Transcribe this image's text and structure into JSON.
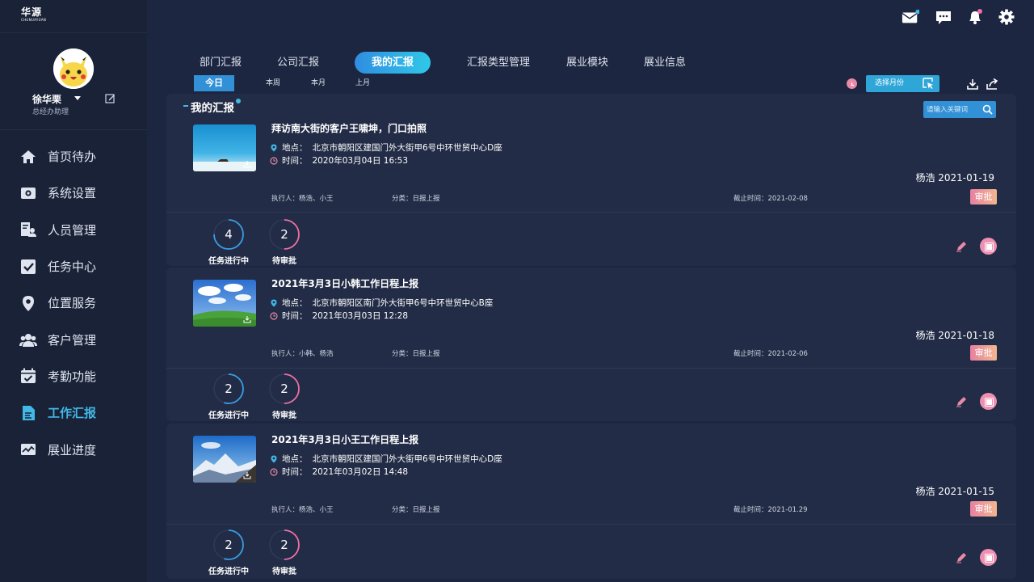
{
  "brand": {
    "name": "华源",
    "sub": "CHUNUAYUAN"
  },
  "user": {
    "name": "徐华栗",
    "role": "总经办助理"
  },
  "nav": [
    {
      "label": "首页待办",
      "icon": "home-icon"
    },
    {
      "label": "系统设置",
      "icon": "settings-icon"
    },
    {
      "label": "人员管理",
      "icon": "people-manage-icon"
    },
    {
      "label": "任务中心",
      "icon": "task-check-icon"
    },
    {
      "label": "位置服务",
      "icon": "location-icon"
    },
    {
      "label": "客户管理",
      "icon": "customers-icon"
    },
    {
      "label": "考勤功能",
      "icon": "calendar-check-icon"
    },
    {
      "label": "工作汇报",
      "icon": "report-icon",
      "active": true
    },
    {
      "label": "展业进度",
      "icon": "trend-icon"
    }
  ],
  "header": {
    "icons": [
      "mail-icon",
      "message-icon",
      "bell-icon",
      "gear-icon"
    ]
  },
  "tabs": [
    {
      "label": "部门汇报"
    },
    {
      "label": "公司汇报"
    },
    {
      "label": "我的汇报",
      "active": true
    },
    {
      "label": "汇报类型管理"
    },
    {
      "label": "展业模块"
    },
    {
      "label": "展业信息"
    }
  ],
  "ranges": [
    {
      "label": "今日",
      "active": true
    },
    {
      "label": "本周"
    },
    {
      "label": "本月"
    },
    {
      "label": "上月"
    }
  ],
  "toolbar": {
    "month_label": "选择月份"
  },
  "section": {
    "title": "我的汇报"
  },
  "search": {
    "placeholder": "请输入关键词"
  },
  "reports": [
    {
      "title": "拜访南大街的客户王啸坤，门口拍照",
      "location_key": "地点：",
      "location": "北京市朝阳区建国门外大街甲6号中环世贸中心D座",
      "time_key": "时间：",
      "time": "2020年03月04日   16:53",
      "executors": "执行人：杨浩、小王",
      "category": "分类：日报上报",
      "deadline": "截止时间：2021-02-08",
      "author": "杨浩  2021-01-19",
      "action": "审批",
      "stats": {
        "progress": "4",
        "progress_label": "任务进行中",
        "pending": "2",
        "pending_label": "待审批"
      },
      "thumb": "sea"
    },
    {
      "title": "2021年3月3日小韩工作日程上报",
      "location_key": "地点：",
      "location": "北京市朝阳区南门外大街甲6号中环世贸中心B座",
      "time_key": "时间：",
      "time": "2021年03月03日   12:28",
      "executors": "执行人：小韩、杨浩",
      "category": "分类：日报上报",
      "deadline": "截止时间：2021-02-06",
      "author": "杨浩  2021-01-18",
      "action": "审批",
      "stats": {
        "progress": "2",
        "progress_label": "任务进行中",
        "pending": "2",
        "pending_label": "待审批"
      },
      "thumb": "meadow"
    },
    {
      "title": "2021年3月3日小王工作日程上报",
      "location_key": "地点：",
      "location": "北京市朝阳区建国门外大街甲6号中环世贸中心D座",
      "time_key": "时间：",
      "time": "2021年03月02日   14:48",
      "executors": "执行人：杨浩、小王",
      "category": "分类：日报上报",
      "deadline": "截止时间：2021-01.29",
      "author": "杨浩  2021-01-15",
      "action": "审批",
      "stats": {
        "progress": "2",
        "progress_label": "任务进行中",
        "pending": "2",
        "pending_label": "待审批"
      },
      "thumb": "mountain"
    }
  ],
  "colors": {
    "accent": "#41b8e6",
    "approve": "#e880a0",
    "bg": "#1c2641",
    "card": "#222c46"
  }
}
